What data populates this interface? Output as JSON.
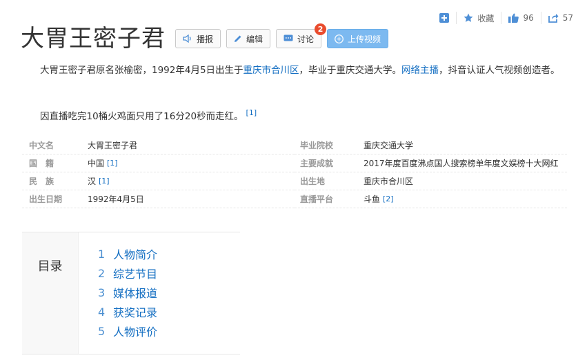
{
  "actions": {
    "add_icon": "plus-square-icon",
    "favorite_label": "收藏",
    "like_count": "96",
    "share_count": "57"
  },
  "title": "大胃王密子君",
  "buttons": {
    "broadcast": "播报",
    "edit": "编辑",
    "discuss": "讨论",
    "discuss_badge": "2",
    "upload_video": "上传视频"
  },
  "summary": {
    "p1_text1": "大胃王密子君原名张榆密，1992年4月5日出生于",
    "p1_link1": "重庆市",
    "p1_link2": "合川区",
    "p1_text2": "，毕业于重庆交通大学。",
    "p1_link3": "网络主播",
    "p1_text3": "，抖音认证人气视频创造者。",
    "p2_text": "因直播吃完10桶火鸡面只用了16分20秒而走红。",
    "p2_ref": "[1]"
  },
  "basic_info": {
    "left": [
      {
        "key": "中文名",
        "value": "大胃王密子君",
        "ref": ""
      },
      {
        "key": "国　籍",
        "value": "中国",
        "ref": "[1]"
      },
      {
        "key": "民　族",
        "value": "汉",
        "ref": "[1]"
      },
      {
        "key": "出生日期",
        "value": "1992年4月5日",
        "ref": ""
      }
    ],
    "right": [
      {
        "key": "毕业院校",
        "value": "重庆交通大学",
        "ref": ""
      },
      {
        "key": "主要成就",
        "value": "2017年度百度沸点国人搜索榜单年度文娱榜十大网红",
        "ref": ""
      },
      {
        "key": "出生地",
        "value_link": "重庆市",
        "value": "合川区",
        "ref": ""
      },
      {
        "key": "直播平台",
        "value": "斗鱼",
        "ref": "[2]"
      }
    ]
  },
  "toc": {
    "label": "目录",
    "items": [
      {
        "num": "1",
        "label": "人物简介"
      },
      {
        "num": "2",
        "label": "综艺节目"
      },
      {
        "num": "3",
        "label": "媒体报道"
      },
      {
        "num": "4",
        "label": "获奖记录"
      },
      {
        "num": "5",
        "label": "人物评价"
      }
    ]
  }
}
